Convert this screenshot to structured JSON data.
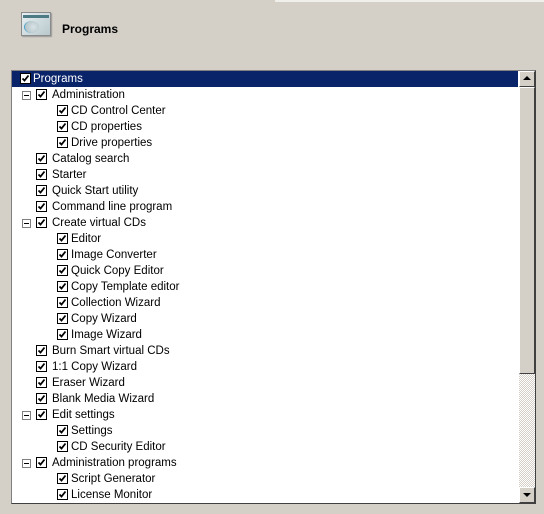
{
  "header": {
    "title": "Programs",
    "icon": "programs-window-icon"
  },
  "tree": {
    "items": [
      {
        "label": "Programs",
        "level": 0,
        "checked": true,
        "expandable": false,
        "selected": true
      },
      {
        "label": "Administration",
        "level": 1,
        "checked": true,
        "expandable": true
      },
      {
        "label": "CD Control Center",
        "level": 2,
        "checked": true
      },
      {
        "label": "CD properties",
        "level": 2,
        "checked": true
      },
      {
        "label": "Drive properties",
        "level": 2,
        "checked": true
      },
      {
        "label": "Catalog search",
        "level": 1,
        "checked": true
      },
      {
        "label": "Starter",
        "level": 1,
        "checked": true
      },
      {
        "label": "Quick Start utility",
        "level": 1,
        "checked": true
      },
      {
        "label": "Command line program",
        "level": 1,
        "checked": true
      },
      {
        "label": "Create virtual CDs",
        "level": 1,
        "checked": true,
        "expandable": true
      },
      {
        "label": "Editor",
        "level": 2,
        "checked": true
      },
      {
        "label": "Image Converter",
        "level": 2,
        "checked": true
      },
      {
        "label": "Quick Copy Editor",
        "level": 2,
        "checked": true
      },
      {
        "label": "Copy Template editor",
        "level": 2,
        "checked": true
      },
      {
        "label": "Collection Wizard",
        "level": 2,
        "checked": true
      },
      {
        "label": "Copy Wizard",
        "level": 2,
        "checked": true
      },
      {
        "label": "Image Wizard",
        "level": 2,
        "checked": true
      },
      {
        "label": "Burn Smart virtual CDs",
        "level": 1,
        "checked": true
      },
      {
        "label": "1:1 Copy Wizard",
        "level": 1,
        "checked": true
      },
      {
        "label": "Eraser Wizard",
        "level": 1,
        "checked": true
      },
      {
        "label": "Blank Media Wizard",
        "level": 1,
        "checked": true
      },
      {
        "label": "Edit settings",
        "level": 1,
        "checked": true,
        "expandable": true
      },
      {
        "label": "Settings",
        "level": 2,
        "checked": true
      },
      {
        "label": "CD Security Editor",
        "level": 2,
        "checked": true
      },
      {
        "label": "Administration programs",
        "level": 1,
        "checked": true,
        "expandable": true
      },
      {
        "label": "Script Generator",
        "level": 2,
        "checked": true
      },
      {
        "label": "License Monitor",
        "level": 2,
        "checked": true
      }
    ]
  },
  "scrollbar": {
    "position": 0,
    "visible_fraction": 0.72
  },
  "colors": {
    "selection": "#0a246a",
    "background": "#d4d0c8"
  }
}
